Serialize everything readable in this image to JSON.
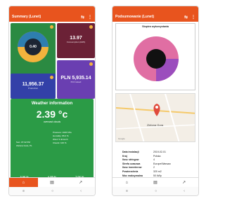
{
  "left": {
    "title": "Summary (Lunet)",
    "tiles": {
      "gauge_value": "0.40",
      "maroon_value": "13.97",
      "maroon_sub": "Consumption (kWh)",
      "blue_value": "11,956.37",
      "blue_sub": "Production",
      "purple_value": "PLN 5,935.14",
      "purple_sub": "PLN saved"
    },
    "weather": {
      "title": "Weather information",
      "temp": "2.39 °c",
      "condition": "overcast clouds",
      "details": [
        "Pressure: 1020 hPa",
        "Humidity: 86.0 %",
        "Wind: 5.40 km/h",
        "Clouds: 100 %"
      ],
      "location": [
        "Sun: 07:32 PM",
        "Zielona Gora, PL"
      ],
      "pcts": [
        "3.06 %",
        "4.35 %",
        "7.06 %"
      ]
    },
    "nav": [
      "home-icon",
      "document-icon",
      "chart-icon"
    ]
  },
  "right": {
    "title": "Podsumowanie (Lunet)",
    "card_title": "Stopien wykorzystania",
    "map_label": "Zielona Gora",
    "map_small": [
      "Google"
    ],
    "info": [
      {
        "k": "Data instalacji",
        "v": "2019-02-01"
      },
      {
        "k": "Kraj",
        "v": "Polska"
      },
      {
        "k": "Ilosc stringow",
        "v": "4"
      },
      {
        "k": "Strefa czasowa",
        "v": "Europe/Warsaw"
      },
      {
        "k": "Ilosc inwerterow",
        "v": "2"
      },
      {
        "k": "Powierzchnia",
        "v": "320 m2"
      },
      {
        "k": "Moc maksymalna",
        "v": "50 kWp"
      }
    ],
    "nav": [
      "home-icon",
      "document-icon",
      "chart-icon"
    ]
  }
}
